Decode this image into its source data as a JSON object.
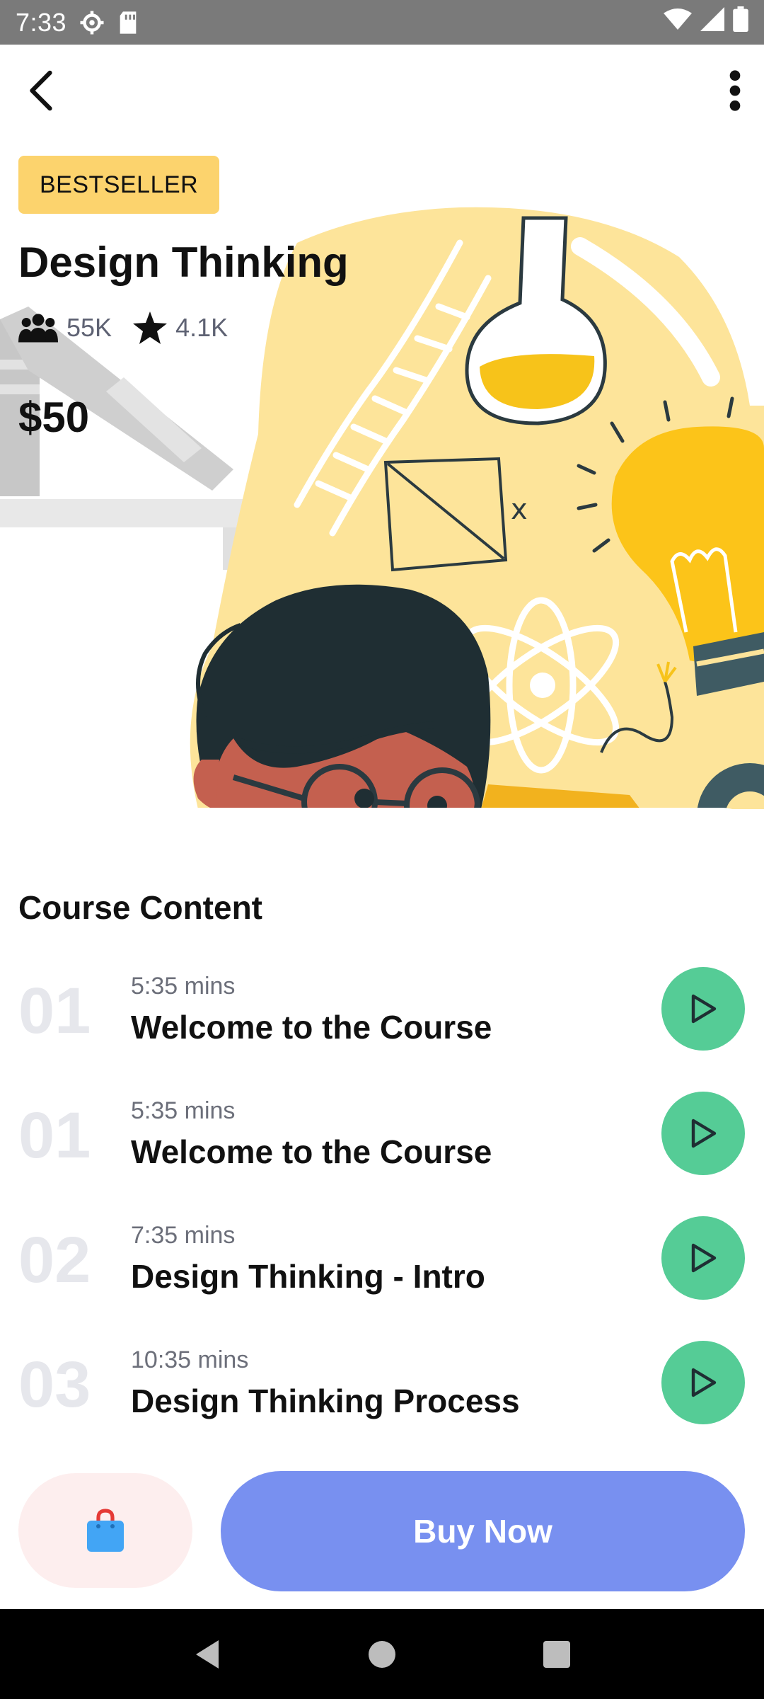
{
  "status_bar": {
    "time": "7:33",
    "icons": [
      "gear-icon",
      "sd-card-icon",
      "wifi-icon",
      "signal-icon",
      "battery-icon"
    ]
  },
  "toolbar": {
    "back_icon": "back-arrow-icon",
    "menu_icon": "more-vertical-icon"
  },
  "course": {
    "badge": "BESTSELLER",
    "title": "Design Thinking",
    "students": "55K",
    "rating": "4.1K",
    "price": "$50"
  },
  "content": {
    "section_title": "Course Content",
    "lessons": [
      {
        "number": "01",
        "duration": "5:35 mins",
        "title": "Welcome to the Course"
      },
      {
        "number": "01",
        "duration": "5:35 mins",
        "title": "Welcome to the Course"
      },
      {
        "number": "02",
        "duration": "7:35 mins",
        "title": "Design Thinking - Intro"
      },
      {
        "number": "03",
        "duration": "10:35 mins",
        "title": "Design Thinking Process"
      }
    ]
  },
  "actions": {
    "cart_icon": "shopping-bag-icon",
    "buy_label": "Buy Now"
  },
  "colors": {
    "badge": "#fcd36d",
    "play": "#55cc96",
    "buy": "#7890f0",
    "cart_bg": "#fdeeee",
    "illustration_yellow": "#fde49a",
    "bulb": "#fcc419"
  }
}
